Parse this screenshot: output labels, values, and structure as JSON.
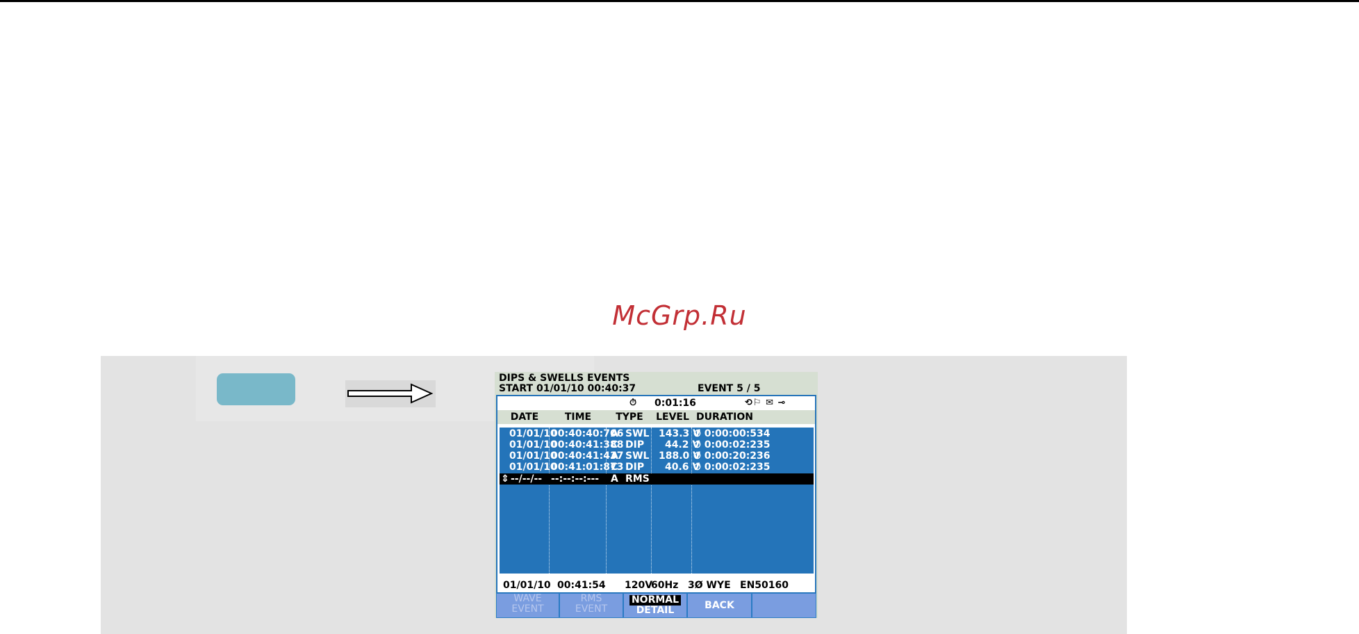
{
  "watermark": "McGrp.Ru",
  "screen": {
    "title": "DIPS & SWELLS EVENTS",
    "start": "START 01/01/10  00:40:37",
    "event": "EVENT  5 / 5",
    "timer_symbol": "⏱",
    "timer": "0:01:16",
    "status_icons": "⟲⚐ ✉ ⊸",
    "columns": [
      "DATE",
      "TIME",
      "TYPE",
      "LEVEL",
      "DURATION"
    ],
    "rows": [
      {
        "marker": "",
        "date": "01/01/10",
        "time": "00:40:40:706",
        "phase": "A",
        "type": "SWL",
        "level": "143.3 V",
        "duration": "⏱ 0:00:00:534"
      },
      {
        "marker": "",
        "date": "01/01/10",
        "time": "00:40:41:388",
        "phase": "C",
        "type": "DIP",
        "level": "44.2 V",
        "duration": "⏱ 0:00:02:235"
      },
      {
        "marker": "",
        "date": "01/01/10",
        "time": "00:40:41:437",
        "phase": "A",
        "type": "SWL",
        "level": "188.0 V",
        "duration": "⏱ 0:00:20:236"
      },
      {
        "marker": "",
        "date": "01/01/10",
        "time": "00:41:01:873",
        "phase": "C",
        "type": "DIP",
        "level": "40.6 V",
        "duration": "⏱ 0:00:02:235"
      },
      {
        "marker": "⇕",
        "date": "--/--/--",
        "time": "--:--:--:---",
        "phase": "A",
        "type": "RMS",
        "level": "",
        "duration": ""
      }
    ],
    "footer": {
      "date": "01/01/10",
      "time": "00:41:54",
      "voltage": "120V",
      "freq": "60Hz",
      "config": "3Ø WYE",
      "standard": "EN50160"
    },
    "softkeys": [
      {
        "line1": "WAVE",
        "line2": "EVENT"
      },
      {
        "line1": "RMS",
        "line2": "EVENT"
      },
      {
        "line1": "NORMAL",
        "line2": "DETAIL"
      },
      {
        "line1": "BACK",
        "line2": ""
      },
      {
        "line1": "",
        "line2": ""
      }
    ]
  }
}
